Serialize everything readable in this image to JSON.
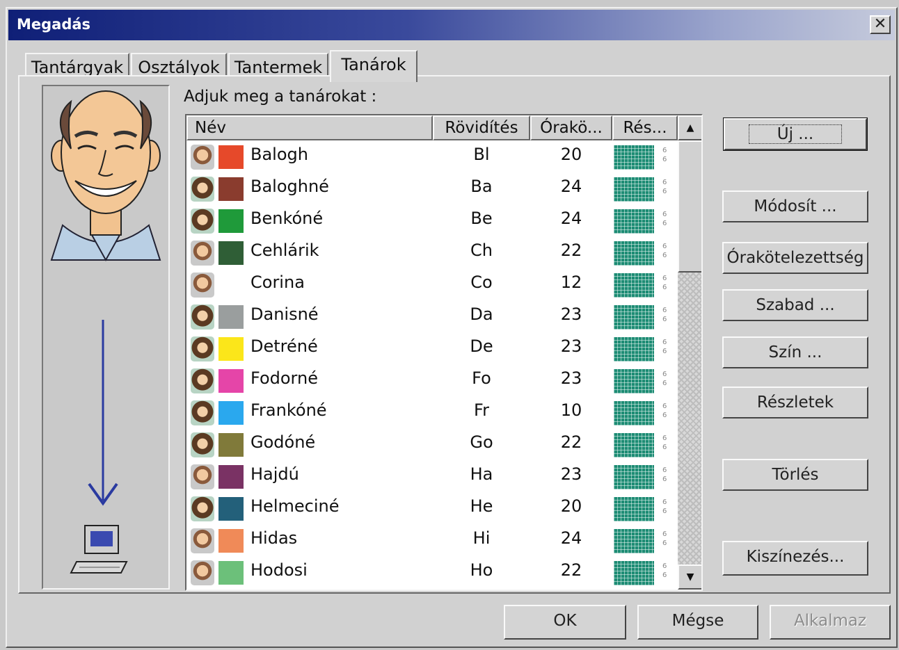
{
  "window": {
    "title": "Megadás"
  },
  "tabs": [
    {
      "label": "Tantárgyak"
    },
    {
      "label": "Osztályok"
    },
    {
      "label": "Tantermek"
    },
    {
      "label": "Tanárok"
    }
  ],
  "prompt": "Adjuk meg a tanárokat :",
  "columns": {
    "name": "Név",
    "abbr": "Rövidítés",
    "hours": "Órakö...",
    "details": "Rés..."
  },
  "teachers": [
    {
      "name": "Balogh",
      "abbr": "Bl",
      "hours": "20",
      "gender": "male",
      "color": "#e6492a"
    },
    {
      "name": "Baloghné",
      "abbr": "Ba",
      "hours": "24",
      "gender": "female",
      "color": "#8a3c2e"
    },
    {
      "name": "Benkóné",
      "abbr": "Be",
      "hours": "24",
      "gender": "female",
      "color": "#1f9a3a"
    },
    {
      "name": "Cehlárik",
      "abbr": "Ch",
      "hours": "22",
      "gender": "male",
      "color": "#2f5e36"
    },
    {
      "name": "Corina",
      "abbr": "Co",
      "hours": "12",
      "gender": "male",
      "color": "#ffffff"
    },
    {
      "name": "Danisné",
      "abbr": "Da",
      "hours": "23",
      "gender": "female",
      "color": "#9a9e9e"
    },
    {
      "name": "Detréné",
      "abbr": "De",
      "hours": "23",
      "gender": "female",
      "color": "#fbe61a"
    },
    {
      "name": "Fodorné",
      "abbr": "Fo",
      "hours": "23",
      "gender": "female",
      "color": "#e545a8"
    },
    {
      "name": "Frankóné",
      "abbr": "Fr",
      "hours": "10",
      "gender": "female",
      "color": "#2aa8ee"
    },
    {
      "name": "Godóné",
      "abbr": "Go",
      "hours": "22",
      "gender": "female",
      "color": "#807a3a"
    },
    {
      "name": "Hajdú",
      "abbr": "Ha",
      "hours": "23",
      "gender": "male",
      "color": "#7a3264"
    },
    {
      "name": "Helmeciné",
      "abbr": "He",
      "hours": "20",
      "gender": "female",
      "color": "#23607a"
    },
    {
      "name": "Hidas",
      "abbr": "Hi",
      "hours": "24",
      "gender": "male",
      "color": "#f08a58"
    },
    {
      "name": "Hodosi",
      "abbr": "Ho",
      "hours": "22",
      "gender": "male",
      "color": "#6cc07a"
    }
  ],
  "side_buttons": {
    "new": "Új ...",
    "modify": "Módosít ...",
    "workload": "Órakötelezettség",
    "free": "Szabad ...",
    "color": "Szín ...",
    "details": "Részletek",
    "delete": "Törlés",
    "colorize": "Kiszínezés..."
  },
  "footer": {
    "ok": "OK",
    "cancel": "Mégse",
    "apply": "Alkalmaz"
  }
}
